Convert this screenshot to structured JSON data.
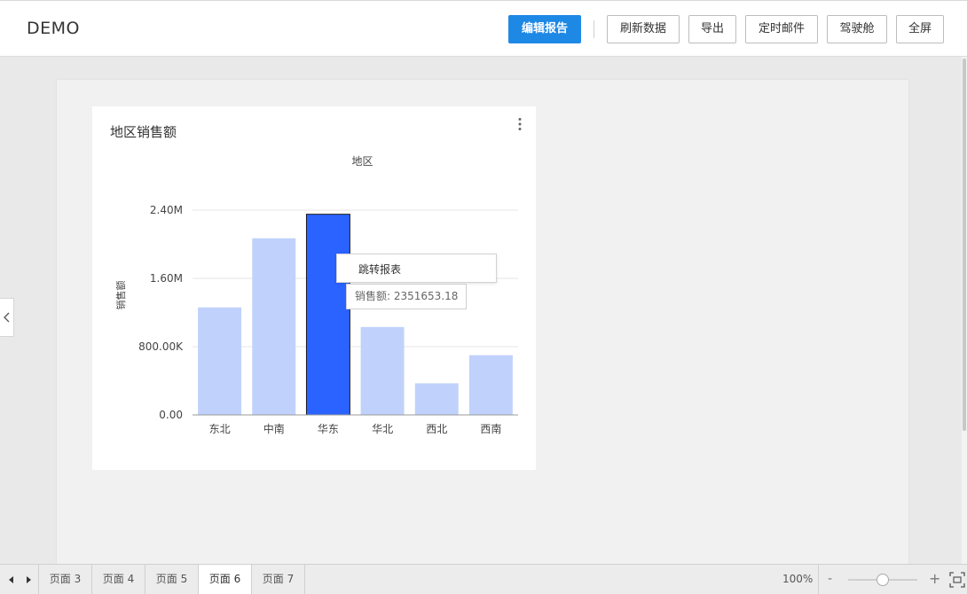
{
  "header": {
    "title": "DEMO",
    "buttons": {
      "edit_report": "编辑报告",
      "refresh": "刷新数据",
      "export": "导出",
      "schedule_mail": "定时邮件",
      "cockpit": "驾驶舱",
      "fullscreen": "全屏"
    },
    "primary_color": "#1e88e5"
  },
  "chart_card": {
    "title": "地区销售额",
    "menu_icon": "more-vertical-icon"
  },
  "chart_data": {
    "type": "bar",
    "title": "地区销售额",
    "subtitle": "地区",
    "xlabel": "",
    "ylabel": "销售额",
    "categories": [
      "东北",
      "中南",
      "华东",
      "华北",
      "西北",
      "西南"
    ],
    "values": [
      1260000,
      2070000,
      2351653.18,
      1030000,
      370000,
      700000
    ],
    "highlighted_index": 2,
    "ylim": [
      0,
      2400000
    ],
    "y_ticks": [
      0,
      800000,
      1600000,
      2400000
    ],
    "y_tick_labels": [
      "0.00",
      "800.00K",
      "1.60M",
      "2.40M"
    ],
    "grid": true,
    "legend": "none",
    "colors": {
      "bar": "#c0d1fb",
      "highlight": "#2a63ff",
      "highlight_border": "#1a1a1a"
    }
  },
  "context_menu": {
    "items": [
      "跳转报表"
    ]
  },
  "tooltip": {
    "text": "销售额: 2351653.18"
  },
  "sidebar_toggle": {
    "icon": "chevron-left-icon"
  },
  "bottom_bar": {
    "tabs": [
      "页面 3",
      "页面 4",
      "页面 5",
      "页面 6",
      "页面 7"
    ],
    "active_tab": "页面 6",
    "zoom": "100%",
    "zoom_minus": "-",
    "zoom_plus": "+",
    "zoom_fraction": 0.5
  }
}
